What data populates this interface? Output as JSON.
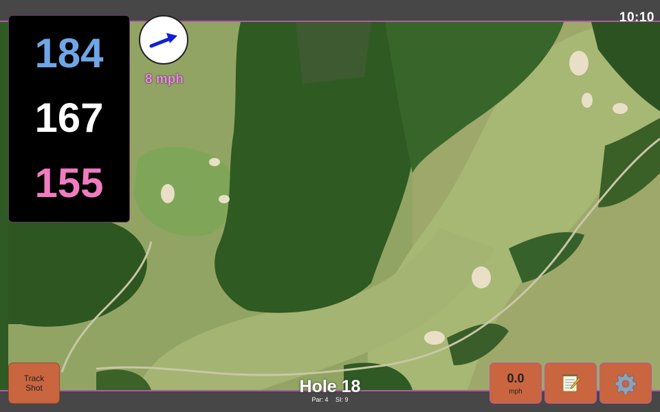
{
  "status": {
    "time": "10:10"
  },
  "distances": {
    "back": "184",
    "middle": "167",
    "front": "155"
  },
  "wind": {
    "speed_label": "8 mph",
    "direction_icon": "arrow-icon"
  },
  "hole": {
    "title": "Hole 18",
    "par": "Par: 4",
    "stroke_index": "SI: 9"
  },
  "buttons": {
    "track_shot": "Track Shot",
    "speed_value": "0.0",
    "speed_unit": "mph",
    "notes_icon": "notepad-icon",
    "settings_icon": "gear-icon"
  },
  "colors": {
    "back_distance": "#6fa6e6",
    "middle_distance": "#ffffff",
    "front_distance": "#f07cc0",
    "button_fill": "#c9653f",
    "accent_border": "#b35aa8"
  }
}
